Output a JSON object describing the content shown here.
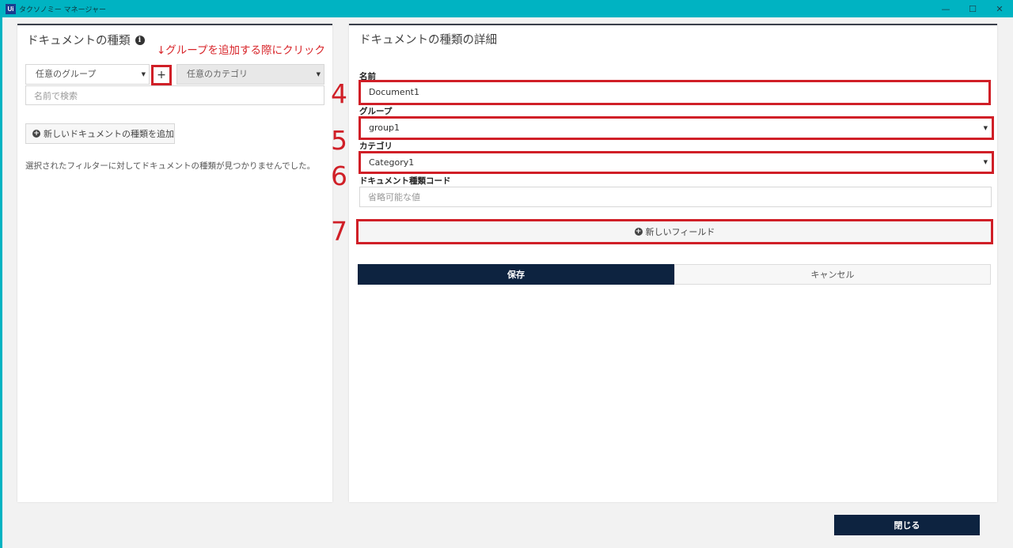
{
  "window": {
    "logo": "Ui",
    "title": "タクソノミー マネージャー",
    "min_glyph": "—",
    "max_glyph": "☐",
    "close_glyph": "✕"
  },
  "left_panel": {
    "title": "ドキュメントの種類",
    "info_icon": "i",
    "annotation": "↓グループを追加する際にクリック",
    "group_select": "任意のグループ",
    "add_group_label": "+",
    "category_select": "任意のカテゴリ",
    "search_placeholder": "名前で検索",
    "add_type_button": "新しいドキュメントの種類を追加",
    "empty_message": "選択されたフィルターに対してドキュメントの種類が見つかりませんでした。"
  },
  "right_panel": {
    "title": "ドキュメントの種類の詳細",
    "name_label": "名前",
    "name_value": "Document1",
    "group_label": "グループ",
    "group_value": "group1",
    "category_label": "カテゴリ",
    "category_value": "Category1",
    "code_label": "ドキュメント種類コード",
    "code_placeholder": "省略可能な値",
    "new_field_button": "新しいフィールド",
    "save_button": "保存",
    "cancel_button": "キャンセル"
  },
  "annotations": {
    "n4": "4",
    "n5": "5",
    "n6": "6",
    "n7": "7"
  },
  "footer": {
    "close_button": "閉じる"
  },
  "colors": {
    "titlebar": "#00b3c2",
    "primary_button": "#0d2340",
    "annotation_red": "#d01f27"
  }
}
